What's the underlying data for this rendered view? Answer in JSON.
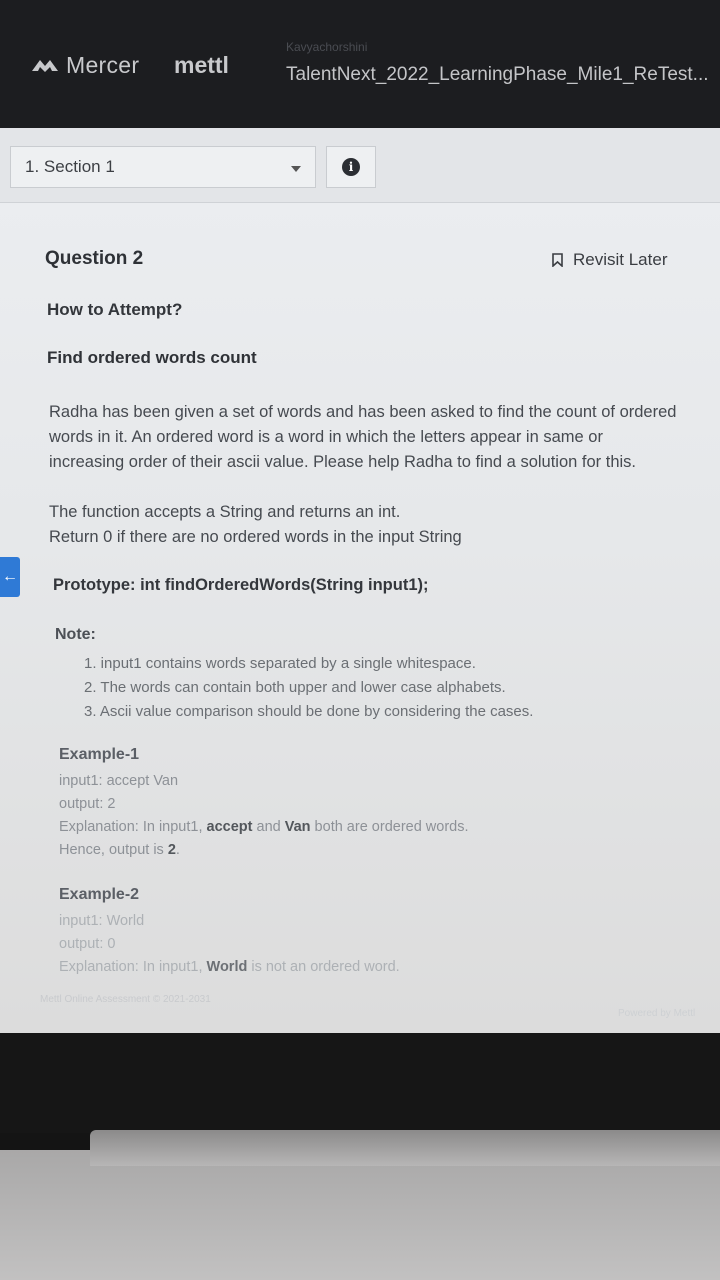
{
  "header": {
    "brand": "Mercer",
    "brand2": "mettl",
    "username": "Kavyachorshini",
    "test_title": "TalentNext_2022_LearningPhase_Mile1_ReTest..."
  },
  "section_select": {
    "value": "1. Section 1"
  },
  "info_icon": "i",
  "question": {
    "title": "Question 2",
    "revisit_label": "Revisit Later",
    "how_to": "How to Attempt?",
    "heading": "Find ordered words count",
    "description": [
      "Radha has been given a set of words and has been asked to find the count of ordered",
      "words in it.  An ordered word is a word in which the letters appear in same or",
      "increasing order of their ascii value. Please help Radha to find a solution for this."
    ],
    "function_desc": [
      "The function accepts a String and returns an int.",
      "Return 0 if there are no ordered words in the input String"
    ],
    "prototype": "Prototype: int findOrderedWords(String input1);",
    "note_heading": "Note:",
    "notes": [
      "1. input1 contains words separated by a single whitespace.",
      "2. The words can contain both upper and lower case alphabets.",
      "3.  Ascii value comparison should be done by considering the cases."
    ],
    "example1": {
      "heading": "Example-1",
      "input": "input1: accept Van",
      "output": "output: 2",
      "explanation_pre": "Explanation: In input1, ",
      "word1": "accept",
      "mid": " and ",
      "word2": "Van",
      "explanation_post": " both are ordered words.",
      "hence_pre": "Hence, output is ",
      "hence_val": "2",
      "hence_post": "."
    },
    "example2": {
      "heading": "Example-2",
      "input": "input1: World",
      "output": "output: 0",
      "explanation_pre": "Explanation: In input1, ",
      "word1": "World",
      "explanation_post": " is not an ordered word."
    }
  },
  "side_tab_icon": "←",
  "footer": {
    "left": "Mettl Online Assessment © 2021-2031",
    "right": "Powered by Mettl"
  },
  "colors": {
    "accent": "#2f7ad6",
    "header_bg": "#1c1d20"
  }
}
